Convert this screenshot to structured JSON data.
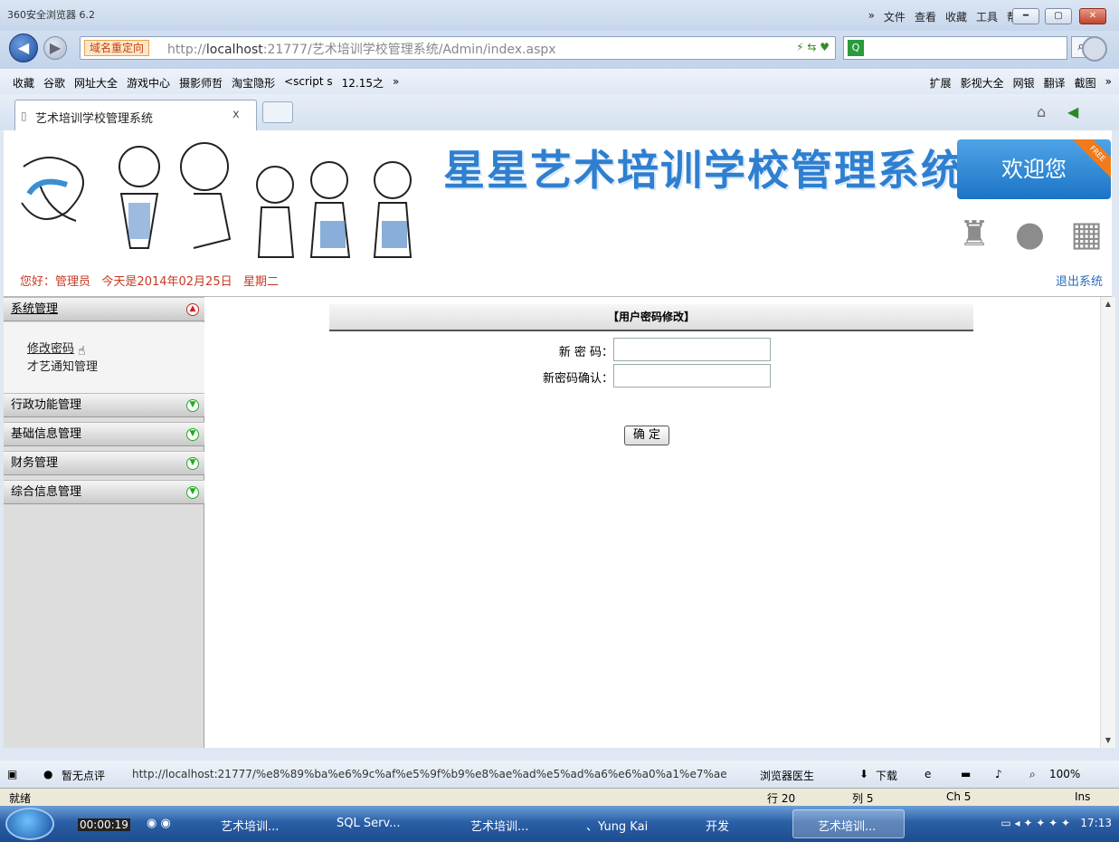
{
  "browser": {
    "app_title": "360安全浏览器 6.2",
    "menu": [
      "»",
      "文件",
      "查看",
      "收藏",
      "工具",
      "帮助"
    ],
    "redirect_badge": "域名重定向",
    "url_prefix": "http://",
    "url_host": "localhost",
    "url_rest": ":21777/艺术培训学校管理系统/Admin/index.aspx",
    "bookmarks": [
      "收藏",
      "谷歌",
      "网址大全",
      "游戏中心",
      "摄影师哲",
      "淘宝隐形",
      "<script s",
      "12.15之",
      "»"
    ],
    "bookmarks_right": [
      "扩展",
      "影视大全",
      "网银",
      "翻译",
      "截图",
      "»"
    ],
    "tab_title": "艺术培训学校管理系统",
    "tab_close": "x"
  },
  "page": {
    "site_title": "星星艺术培训学校管理系统",
    "welcome": "欢迎您",
    "ribbon": "FREE",
    "greeting": "您好：管理员",
    "date": "今天是2014年02月25日",
    "weekday": "星期二",
    "logout": "退出系统",
    "os_icons": [
      "android-icon",
      "apple-icon",
      "windows-icon"
    ]
  },
  "sidebar": {
    "sections": [
      {
        "label": "系统管理",
        "expanded": true,
        "items": [
          "修改密码",
          "才艺通知管理"
        ]
      },
      {
        "label": "行政功能管理",
        "expanded": false
      },
      {
        "label": "基础信息管理",
        "expanded": false
      },
      {
        "label": "财务管理",
        "expanded": false
      },
      {
        "label": "综合信息管理",
        "expanded": false
      }
    ]
  },
  "form": {
    "title": "【用户密码修改】",
    "new_password_label": "新 密 码：",
    "new_password_value": "",
    "confirm_label": "新密码确认：",
    "confirm_value": "",
    "submit": "确 定"
  },
  "statusbar": {
    "rating": "暂无点评",
    "link_url": "http://localhost:21777/%e8%89%ba%e6%9c%af%e5%9f%b9%e8%ae%ad%e5%ad%a6%e6%a0%a1%e7%ae",
    "doctor": "浏览器医生",
    "download": "下载",
    "zoom": "100%",
    "ready": "就绪",
    "row": "行 20",
    "col": "列 5",
    "ch": "Ch 5",
    "ins": "Ins"
  },
  "taskbar": {
    "timer": "00:00:19",
    "items": [
      "艺术培训...",
      "SQL Serv...",
      "艺术培训...",
      "、Yung Kai",
      "开发",
      "艺术培训..."
    ],
    "clock": "17:13"
  }
}
